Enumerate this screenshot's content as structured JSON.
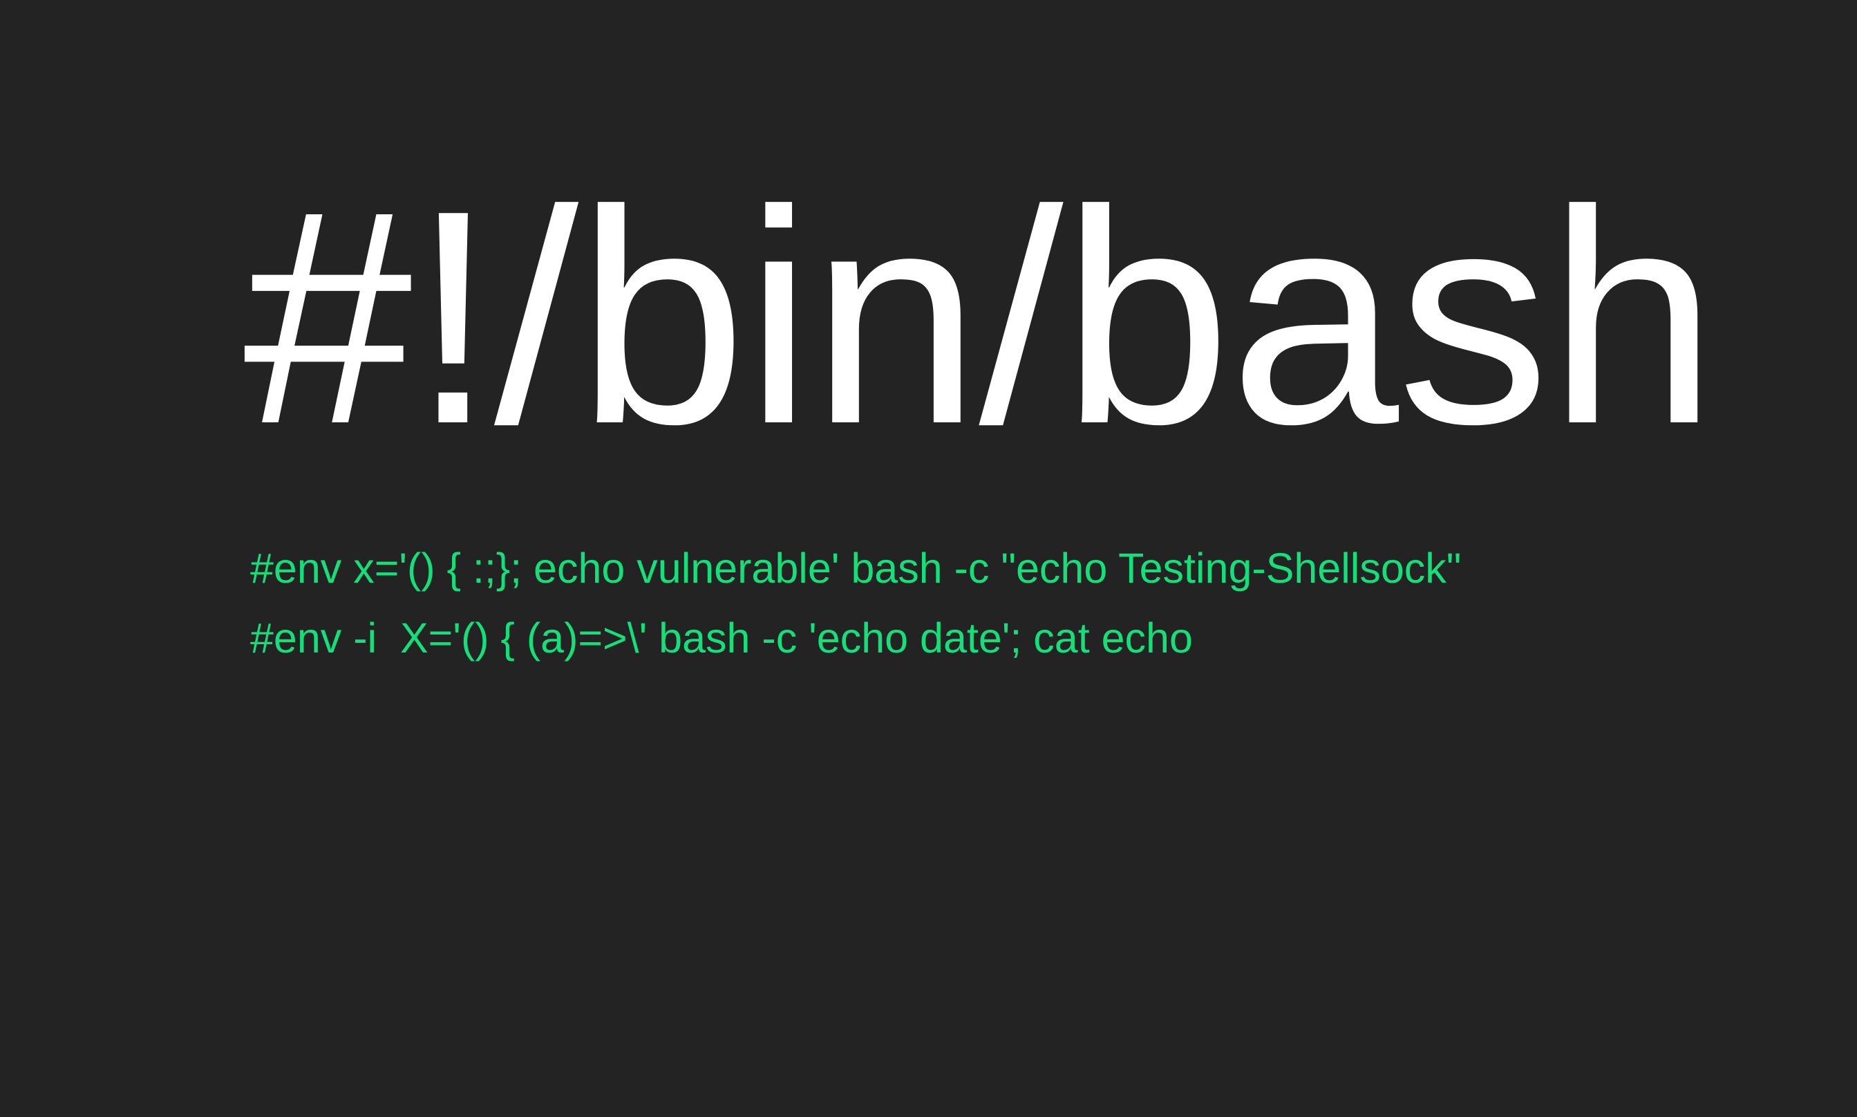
{
  "slide": {
    "background_color": "#232323",
    "title": "#!/bin/bash",
    "title_color": "#ffffff",
    "command_color": "#14e07a",
    "commands": [
      "#env x='() { :;}; echo vulnerable' bash -c \"echo Testing-Shellsock\"",
      "#env -i  X='() { (a)=>\\' bash -c 'echo date'; cat echo"
    ]
  }
}
